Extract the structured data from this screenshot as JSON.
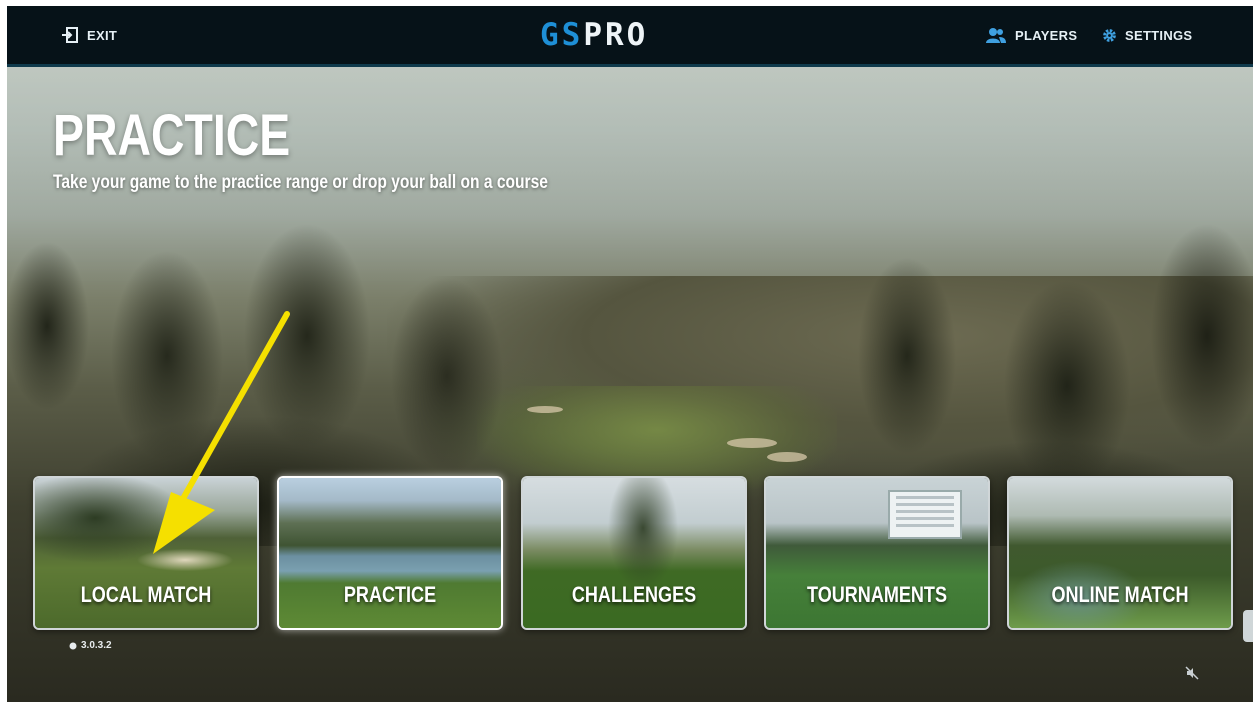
{
  "topbar": {
    "exit_label": "EXIT",
    "logo_gs": "GS",
    "logo_pro": "PRO",
    "players_label": "PLAYERS",
    "settings_label": "SETTINGS"
  },
  "header": {
    "title": "PRACTICE",
    "subtitle": "Take your game to the practice range or drop your ball on a course"
  },
  "cards": [
    {
      "label": "LOCAL MATCH"
    },
    {
      "label": "PRACTICE"
    },
    {
      "label": "CHALLENGES"
    },
    {
      "label": "TOURNAMENTS"
    },
    {
      "label": "ONLINE MATCH"
    }
  ],
  "footer": {
    "version": "3.0.3.2"
  },
  "colors": {
    "topbar_bg": "#061218",
    "logo_accent": "#1e8fd6",
    "arrow": "#f5e000"
  }
}
